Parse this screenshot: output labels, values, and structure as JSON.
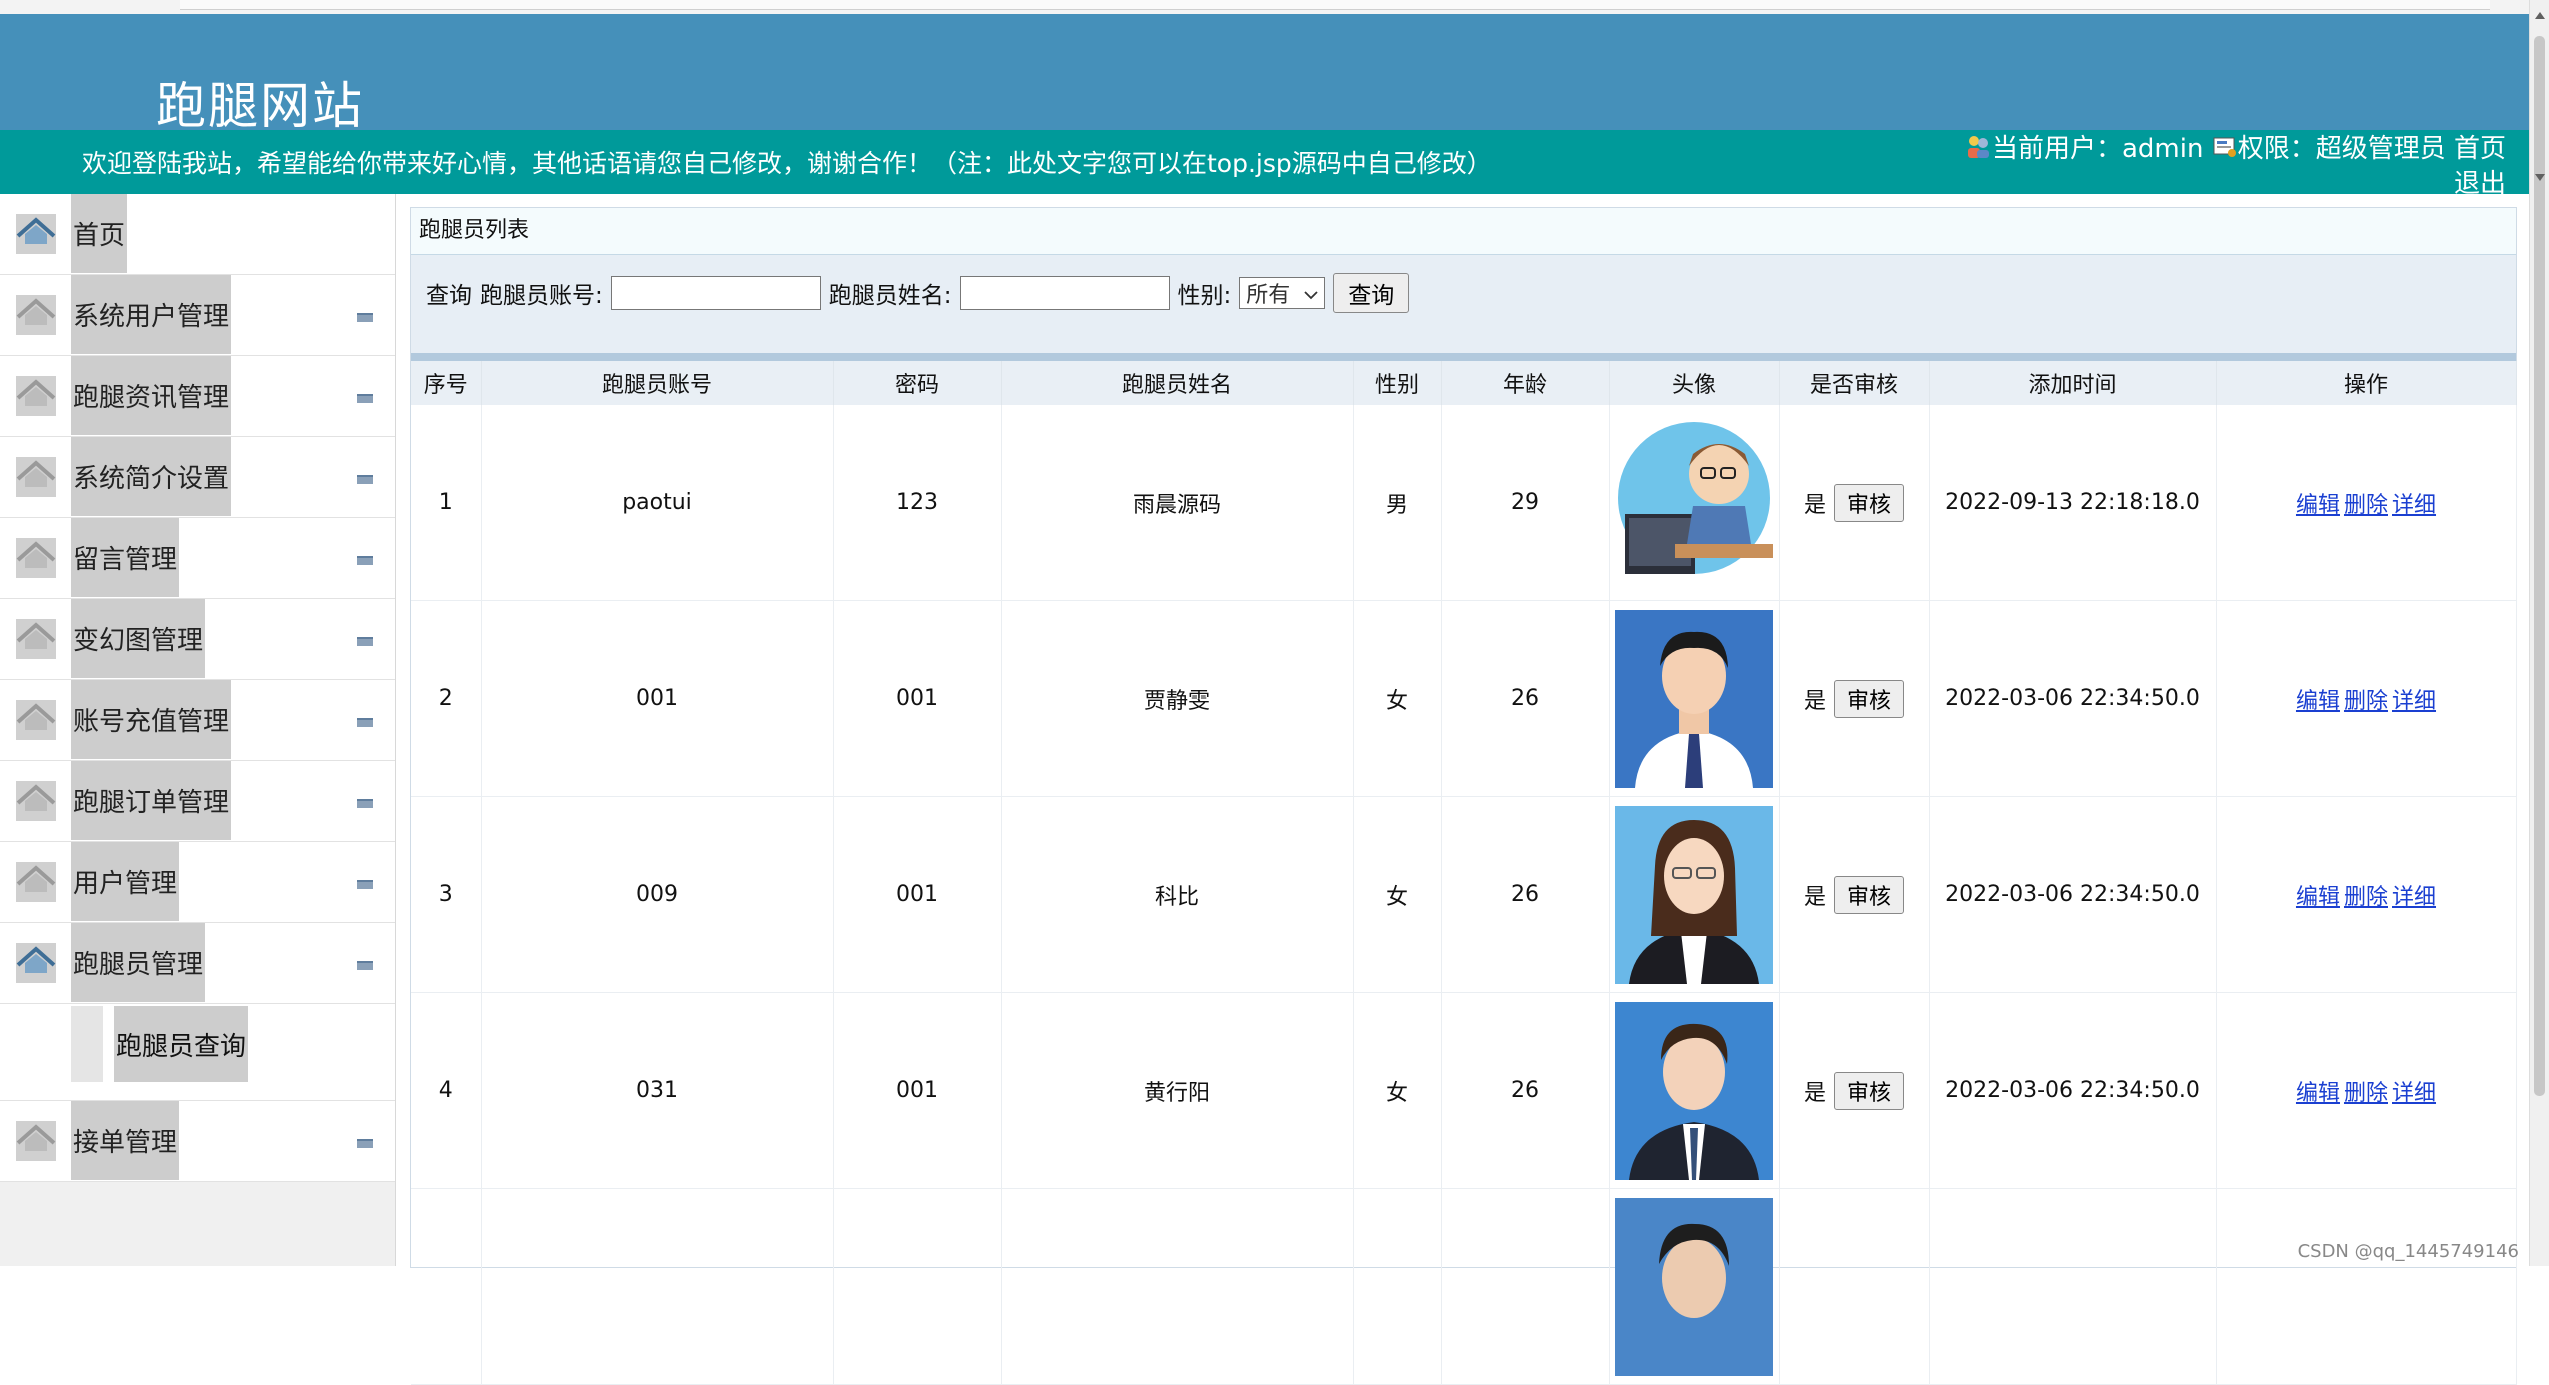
{
  "header": {
    "site_title": "跑腿网站",
    "welcome": "欢迎登陆我站，希望能给你带来好心情，其他话语请您自己修改，谢谢合作！（注：此处文字您可以在top.jsp源码中自己修改）",
    "user_label": "当前用户：admin",
    "role_label": "权限：超级管理员",
    "home_link": "首页",
    "logout_link": "退出"
  },
  "sidebar": {
    "items": [
      {
        "label": "首页"
      },
      {
        "label": "系统用户管理"
      },
      {
        "label": "跑腿资讯管理"
      },
      {
        "label": "系统简介设置"
      },
      {
        "label": "留言管理"
      },
      {
        "label": "变幻图管理"
      },
      {
        "label": "账号充值管理"
      },
      {
        "label": "跑腿订单管理"
      },
      {
        "label": "用户管理"
      },
      {
        "label": "跑腿员管理"
      },
      {
        "label": "接单管理"
      }
    ],
    "sub_item": "跑腿员查询"
  },
  "panel": {
    "title": "跑腿员列表",
    "search_prefix": "查询",
    "account_label": "跑腿员账号:",
    "name_label": "跑腿员姓名:",
    "gender_label": "性别:",
    "gender_selected": "所有",
    "search_button": "查询"
  },
  "table": {
    "columns": [
      "序号",
      "跑腿员账号",
      "密码",
      "跑腿员姓名",
      "性别",
      "年龄",
      "头像",
      "是否审核",
      "添加时间",
      "操作"
    ],
    "rows": [
      {
        "no": "1",
        "account": "paotui",
        "password": "123",
        "name": "雨晨源码",
        "gender": "男",
        "age": "29",
        "approved": "是",
        "audit_btn": "审核",
        "time": "2022-09-13 22:18:18.0"
      },
      {
        "no": "2",
        "account": "001",
        "password": "001",
        "name": "贾静雯",
        "gender": "女",
        "age": "26",
        "approved": "是",
        "audit_btn": "审核",
        "time": "2022-03-06 22:34:50.0"
      },
      {
        "no": "3",
        "account": "009",
        "password": "001",
        "name": "科比",
        "gender": "女",
        "age": "26",
        "approved": "是",
        "audit_btn": "审核",
        "time": "2022-03-06 22:34:50.0"
      },
      {
        "no": "4",
        "account": "031",
        "password": "001",
        "name": "黄行阳",
        "gender": "女",
        "age": "26",
        "approved": "是",
        "audit_btn": "审核",
        "time": "2022-03-06 22:34:50.0"
      }
    ],
    "actions": {
      "edit": "编辑",
      "delete": "删除",
      "detail": "详细"
    }
  },
  "watermark": "CSDN @qq_1445749146",
  "colors": {
    "header": "#4590ba",
    "infobar": "#009a9a",
    "link": "#1a3fd1"
  }
}
